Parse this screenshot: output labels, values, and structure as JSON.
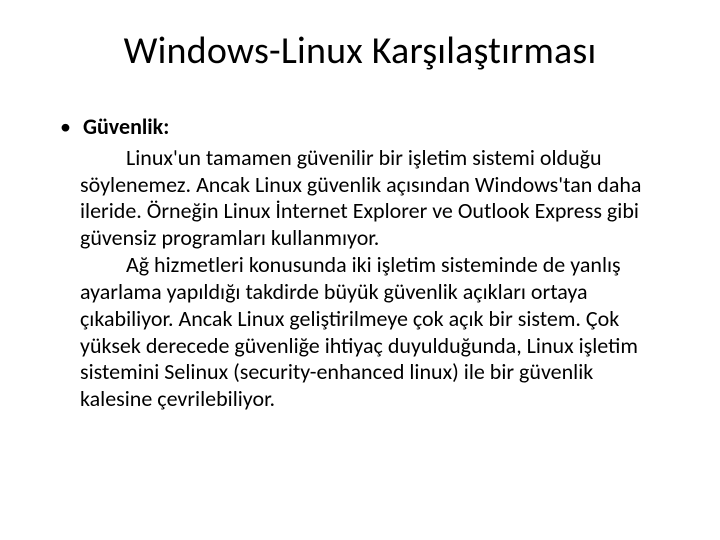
{
  "title": "Windows-Linux Karşılaştırması",
  "bullet": {
    "symbol": "•",
    "label": "Güvenlik:"
  },
  "paragraphs": {
    "p1": "Linux'un tamamen güvenilir bir işletim sistemi olduğu söylenemez. Ancak Linux güvenlik açısından Windows'tan daha ileride. Örneğin Linux İnternet Explorer ve Outlook Express gibi güvensiz programları kullanmıyor.",
    "p2": "Ağ hizmetleri konusunda iki işletim sisteminde de yanlış ayarlama yapıldığı takdirde büyük güvenlik açıkları ortaya çıkabiliyor. Ancak Linux geliştirilmeye çok açık bir sistem. Çok yüksek derecede güvenliğe ihtiyaç duyulduğunda, Linux işletim sistemini Selinux (security-enhanced linux) ile bir güvenlik kalesine çevrilebiliyor."
  }
}
